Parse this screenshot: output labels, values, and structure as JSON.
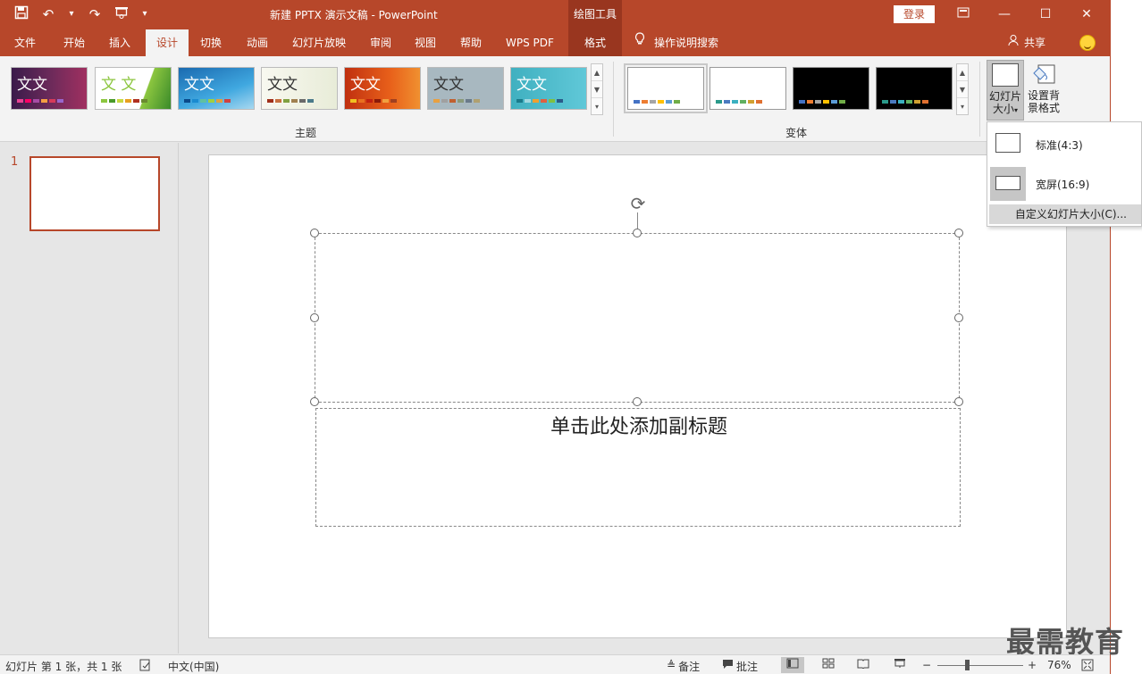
{
  "app": {
    "title": "新建 PPTX 演示文稿  -  PowerPoint",
    "context_tab_header": "绘图工具",
    "login_label": "登录"
  },
  "qat": {
    "save_icon": "save-icon",
    "undo_icon": "undo-icon",
    "redo_icon": "redo-icon",
    "present_icon": "present-icon"
  },
  "tabs": [
    {
      "label": "文件"
    },
    {
      "label": "开始"
    },
    {
      "label": "插入"
    },
    {
      "label": "设计"
    },
    {
      "label": "切换"
    },
    {
      "label": "动画"
    },
    {
      "label": "幻灯片放映"
    },
    {
      "label": "审阅"
    },
    {
      "label": "视图"
    },
    {
      "label": "帮助"
    },
    {
      "label": "WPS PDF"
    },
    {
      "label": "格式"
    }
  ],
  "active_tab": "设计",
  "search_label": "操作说明搜索",
  "share_label": "共享",
  "ribbon": {
    "themes_group_label": "主题",
    "variants_group_label": "变体",
    "theme_thumb_text": "文文",
    "theme_thumb_text_alt": "文 文",
    "slide_size_label_1": "幻灯片",
    "slide_size_label_2": "大小",
    "format_bg_label_1": "设置背",
    "format_bg_label_2": "景格式"
  },
  "dropdown": {
    "standard_label": "标准(4:3)",
    "widescreen_label": "宽屏(16:9)",
    "custom_label": "自定义幻灯片大小(C)..."
  },
  "slide_pane": {
    "slide_number": "1"
  },
  "slide": {
    "subtitle_placeholder": "单击此处添加副标题"
  },
  "watermark": "最需教育",
  "status": {
    "slide_info": "幻灯片 第 1 张，共 1 张",
    "language": "中文(中国)",
    "notes_label": "备注",
    "comments_label": "批注",
    "zoom_minus": "−",
    "zoom_plus": "+",
    "zoom_level": "76%"
  },
  "colors": {
    "accent": "#b7472a",
    "context_tab": "#99361f"
  }
}
